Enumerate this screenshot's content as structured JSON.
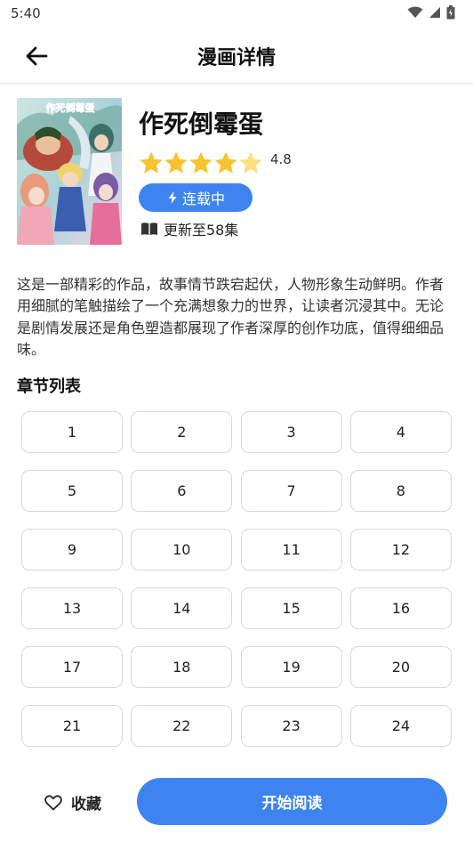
{
  "status_bar": {
    "time": "5:40"
  },
  "header": {
    "title": "漫画详情"
  },
  "comic": {
    "cover_caption": "作死倒霉蛋",
    "title": "作死倒霉蛋",
    "rating": 4.8,
    "rating_text": "4.8",
    "status": "连载中",
    "update_text": "更新至58集",
    "description": "这是一部精彩的作品，故事情节跌宕起伏，人物形象生动鲜明。作者用细腻的笔触描绘了一个充满想象力的世界，让读者沉浸其中。无论是剧情发展还是角色塑造都展现了作者深厚的创作功底，值得细细品味。"
  },
  "chapters": {
    "title": "章节列表",
    "items": [
      "1",
      "2",
      "3",
      "4",
      "5",
      "6",
      "7",
      "8",
      "9",
      "10",
      "11",
      "12",
      "13",
      "14",
      "15",
      "16",
      "17",
      "18",
      "19",
      "20",
      "21",
      "22",
      "23",
      "24"
    ]
  },
  "actions": {
    "favorite_label": "收藏",
    "read_label": "开始阅读"
  },
  "colors": {
    "accent": "#3d84f0",
    "star": "#f7c430",
    "star_empty": "#f9e27e"
  },
  "icons": [
    "wifi-icon",
    "signal-icon",
    "battery-icon",
    "back-arrow-icon",
    "star-icon",
    "lightning-icon",
    "book-icon",
    "heart-icon"
  ]
}
